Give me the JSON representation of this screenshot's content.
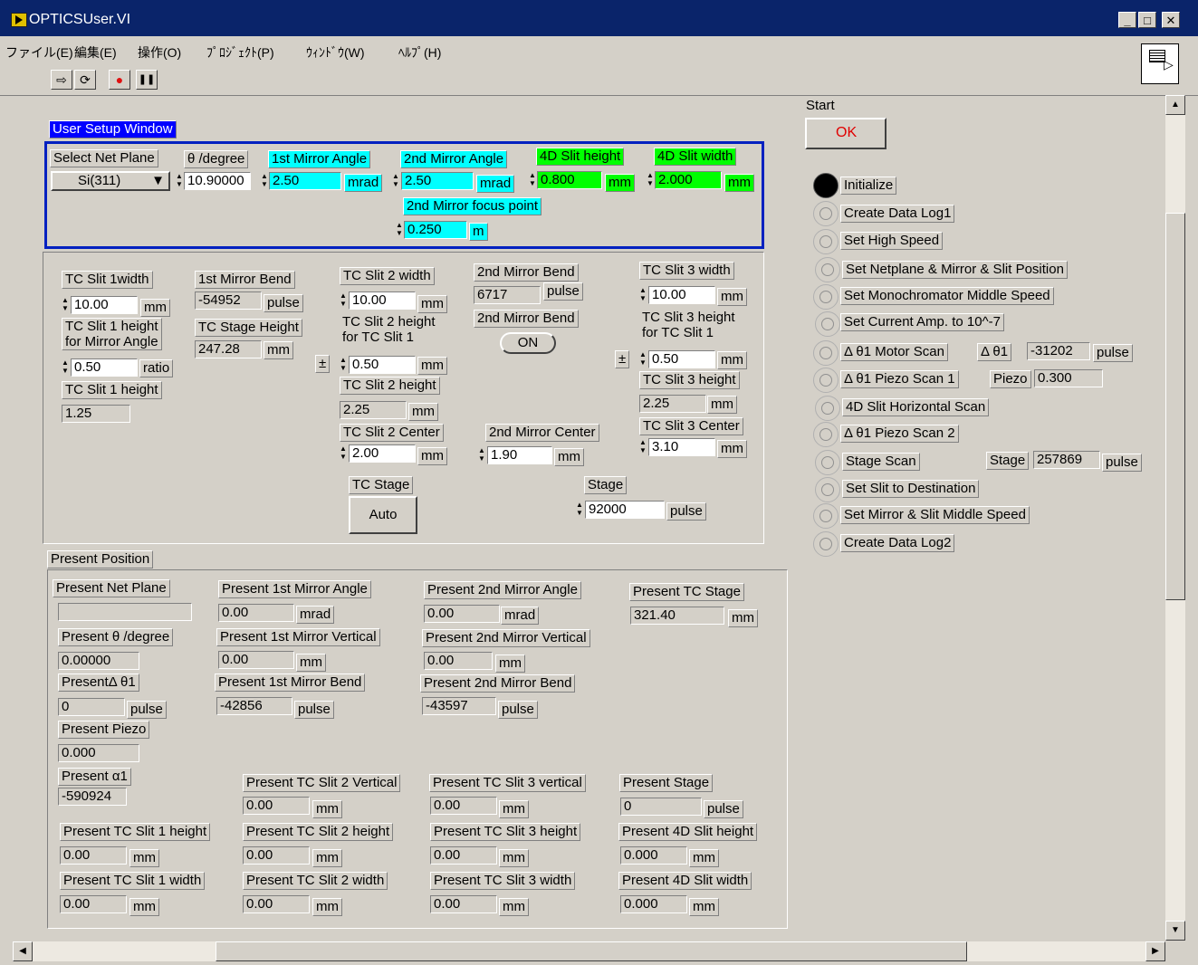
{
  "window": {
    "title": "OPTICSUser.VI"
  },
  "menu": [
    "ファイル(E)",
    "編集(E)",
    "操作(O)",
    "ﾌﾟﾛｼﾞｪｸﾄ(P)",
    "ｳｨﾝﾄﾞｳ(W)",
    "ﾍﾙﾌﾟ(H)"
  ],
  "toolbar": {
    "run": "⇨",
    "run_continuous": "⟳",
    "abort": "●",
    "pause": "❚❚"
  },
  "setup": {
    "title": "User Setup Window",
    "net_plane_label": "Select Net Plane",
    "net_plane_value": "Si(311)",
    "theta_label": "θ /degree",
    "theta_value": "10.90000",
    "mirror1_angle_label": "1st Mirror Angle",
    "mirror1_angle_value": "2.50",
    "mirror2_angle_label": "2nd Mirror Angle",
    "mirror2_angle_value": "2.50",
    "slit4d_height_label": "4D Slit height",
    "slit4d_height_value": "0.800",
    "slit4d_width_label": "4D Slit width",
    "slit4d_width_value": "2.000",
    "mirror2_focus_label": "2nd Mirror focus point",
    "mirror2_focus_value": "0.250",
    "unit_mrad": "mrad",
    "unit_mm": "mm",
    "unit_m": "m"
  },
  "tc": {
    "slit1_width_label": "TC Slit 1width",
    "slit1_width_value": "10.00",
    "slit1_height_mirror_label1": "TC Slit 1 height",
    "slit1_height_mirror_label2": "for Mirror Angle",
    "slit1_ratio_value": "0.50",
    "unit_ratio": "ratio",
    "slit1_height_label": "TC Slit 1 height",
    "slit1_height_value": "1.25",
    "mirror1_bend_label": "1st Mirror Bend",
    "mirror1_bend_value": "-54952",
    "unit_pulse": "pulse",
    "stage_height_label": "TC Stage Height",
    "stage_height_value": "247.28",
    "slit2_width_label": "TC Slit 2 width",
    "slit2_width_value": "10.00",
    "slit2_height_for1_label1": "TC Slit 2 height",
    "slit2_height_for1_label2": "for TC Slit 1",
    "pm": "±",
    "slit2_for1_value": "0.50",
    "slit2_height_label": "TC Slit 2 height",
    "slit2_height_value": "2.25",
    "slit2_center_label": "TC Slit 2 Center",
    "slit2_center_value": "2.00",
    "mirror2_bend_label": "2nd Mirror Bend",
    "mirror2_bend_value": "6717",
    "mirror2_bend_switch_label": "2nd Mirror Bend",
    "mirror2_bend_switch_value": "ON",
    "mirror2_center_label": "2nd Mirror Center",
    "mirror2_center_value": "1.90",
    "slit3_width_label": "TC Slit 3 width",
    "slit3_width_value": "10.00",
    "slit3_height_for1_label1": "TC Slit 3 height",
    "slit3_height_for1_label2": "for TC Slit 1",
    "slit3_for1_value": "0.50",
    "slit3_height_label": "TC Slit 3 height",
    "slit3_height_value": "2.25",
    "slit3_center_label": "TC Slit 3 Center",
    "slit3_center_value": "3.10",
    "stage_label": "TC Stage",
    "stage_button": "Auto",
    "stage2_label": "Stage",
    "stage2_value": "92000"
  },
  "present": {
    "title": "Present Position",
    "net_plane_label": "Present Net Plane",
    "net_plane_value": "",
    "theta_label": "Present θ /degree",
    "theta_value": "0.00000",
    "dtheta_label": "PresentΔ θ1",
    "dtheta_value": "0",
    "piezo_label": "Present Piezo",
    "piezo_value": "0.000",
    "alpha_label": "Present α1",
    "alpha_value": "-590924",
    "m1_angle_label": "Present 1st Mirror Angle",
    "m1_angle_value": "0.00",
    "m1_vert_label": "Present 1st Mirror Vertical",
    "m1_vert_value": "0.00",
    "m1_bend_label": "Present 1st Mirror Bend",
    "m1_bend_value": "-42856",
    "m2_angle_label": "Present 2nd Mirror Angle",
    "m2_angle_value": "0.00",
    "m2_vert_label": "Present 2nd Mirror Vertical",
    "m2_vert_value": "0.00",
    "m2_bend_label": "Present 2nd Mirror Bend",
    "m2_bend_value": "-43597",
    "tc_stage_label": "Present TC Stage",
    "tc_stage_value": "321.40",
    "slit2_vert_label": "Present TC Slit 2 Vertical",
    "slit2_vert_value": "0.00",
    "slit3_vert_label": "Present TC Slit 3 vertical",
    "slit3_vert_value": "0.00",
    "stage_label": "Present Stage",
    "stage_value": "0",
    "slit1_h_label": "Present TC Slit 1 height",
    "slit1_h_value": "0.00",
    "slit2_h_label": "Present TC Slit 2 height",
    "slit2_h_value": "0.00",
    "slit3_h_label": "Present TC Slit 3 height",
    "slit3_h_value": "0.00",
    "slit4d_h_label": "Present 4D Slit height",
    "slit4d_h_value": "0.000",
    "slit1_w_label": "Present TC Slit 1 width",
    "slit1_w_value": "0.00",
    "slit2_w_label": "Present TC Slit 2 width",
    "slit2_w_value": "0.00",
    "slit3_w_label": "Present TC Slit 3 width",
    "slit3_w_value": "0.00",
    "slit4d_w_label": "Present 4D Slit width",
    "slit4d_w_value": "0.000",
    "unit_mm": "mm",
    "unit_mrad": "mrad",
    "unit_pulse": "pulse"
  },
  "start": {
    "label": "Start",
    "ok": "OK"
  },
  "steps": [
    {
      "label": "Initialize",
      "active": true
    },
    {
      "label": "Create Data Log1"
    },
    {
      "label": "Set High Speed"
    },
    {
      "label": "Set Netplane & Mirror & Slit Position"
    },
    {
      "label": "Set Monochromator Middle Speed"
    },
    {
      "label": "Set Current Amp. to 10^-7"
    },
    {
      "label": "Δ θ1 Motor Scan"
    },
    {
      "label": "Δ θ1 Piezo Scan 1"
    },
    {
      "label": "4D Slit Horizontal Scan"
    },
    {
      "label": "Δ θ1 Piezo Scan 2"
    },
    {
      "label": "Stage Scan"
    },
    {
      "label": "Set Slit to Destination"
    },
    {
      "label": "Set Mirror & Slit Middle Speed"
    },
    {
      "label": "Create Data Log2"
    }
  ],
  "step_extras": {
    "dtheta_label": "Δ θ1",
    "dtheta_value": "-31202",
    "piezo_label": "Piezo",
    "piezo_value": "0.300",
    "stage_label": "Stage",
    "stage_value": "257869",
    "unit_pulse": "pulse"
  }
}
